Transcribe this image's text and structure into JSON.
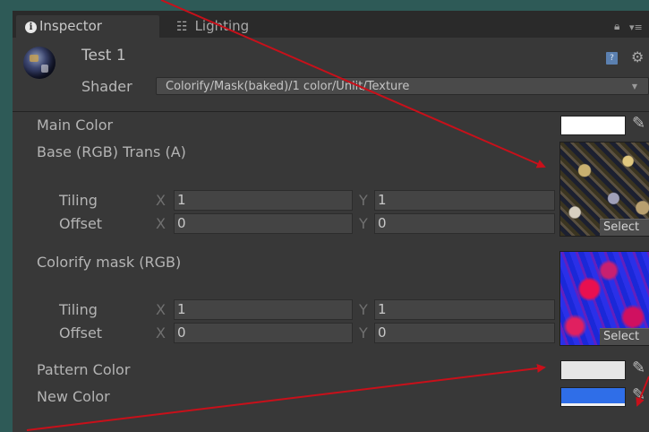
{
  "tabs": [
    {
      "label": "Inspector",
      "icon": "info-icon",
      "active": true
    },
    {
      "label": "Lighting",
      "icon": "lighting-icon",
      "active": false
    }
  ],
  "header": {
    "material_name": "Test 1",
    "shader_label": "Shader",
    "shader_value": "Colorify/Mask(baked)/1 color/Unlit/Texture"
  },
  "properties": {
    "main_color": {
      "label": "Main Color",
      "color": "#ffffff"
    },
    "base_texture": {
      "label": "Base (RGB) Trans (A)",
      "tiling": {
        "label": "Tiling",
        "x_axis": "X",
        "x": "1",
        "y_axis": "Y",
        "y": "1"
      },
      "offset": {
        "label": "Offset",
        "x_axis": "X",
        "x": "0",
        "y_axis": "Y",
        "y": "0"
      },
      "select_label": "Select"
    },
    "colorify_mask": {
      "label": "Colorify mask (RGB)",
      "tiling": {
        "label": "Tiling",
        "x_axis": "X",
        "x": "1",
        "y_axis": "Y",
        "y": "1"
      },
      "offset": {
        "label": "Offset",
        "x_axis": "X",
        "x": "0",
        "y_axis": "Y",
        "y": "0"
      },
      "select_label": "Select"
    },
    "pattern_color": {
      "label": "Pattern Color",
      "color": "#e6e6e6"
    },
    "new_color": {
      "label": "New Color",
      "color": "#2f6ee8"
    }
  },
  "colors": {
    "background": "#2e5a57",
    "panel": "#383838",
    "annotation_arrow": "#c8101a"
  }
}
